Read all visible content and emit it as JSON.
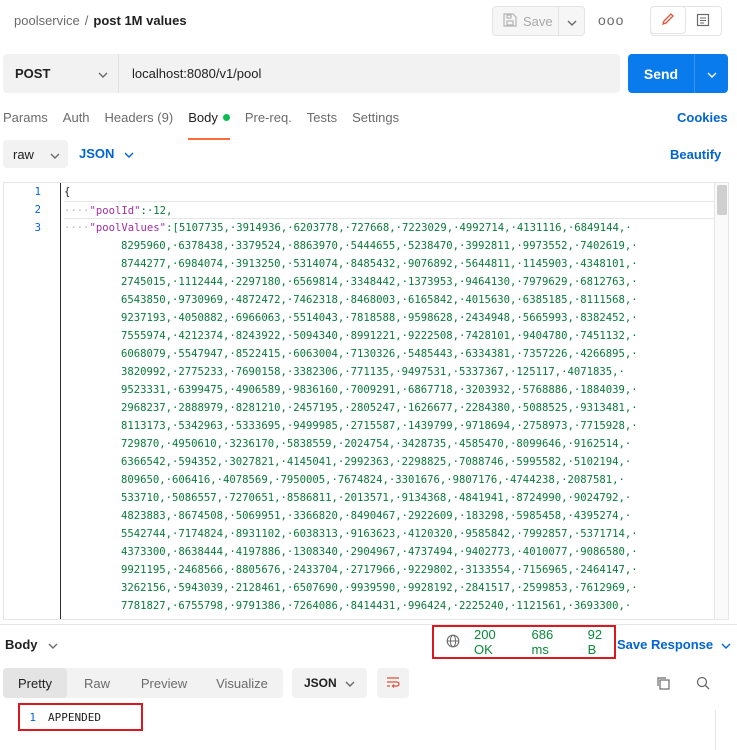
{
  "breadcrumb": {
    "parent": "poolservice",
    "separator": "/",
    "title": "post 1M values"
  },
  "toolbar": {
    "save_label": "Save",
    "more_label": "ooo"
  },
  "request": {
    "method": "POST",
    "url": "localhost:8080/v1/pool",
    "send_label": "Send"
  },
  "tabs": [
    {
      "label": "Params"
    },
    {
      "label": "Auth"
    },
    {
      "label": "Headers (9)"
    },
    {
      "label": "Body"
    },
    {
      "label": "Pre-req."
    },
    {
      "label": "Tests"
    },
    {
      "label": "Settings"
    }
  ],
  "cookies_label": "Cookies",
  "body_options": {
    "mode": "raw",
    "language": "JSON",
    "beautify_label": "Beautify"
  },
  "editor": {
    "line_numbers": [
      "1",
      "2",
      "3"
    ],
    "line1": "{",
    "line2_indent": "····",
    "line2_key": "\"poolId\"",
    "line2_rest": ":·12,",
    "line3_indent": "····",
    "line3_key": "\"poolValues\"",
    "line3_rest": ":[5107735,·3914936,·6203778,·727668,·7223029,·4992714,·4131116,·6849144,·",
    "continuation": [
      "8295960,·6378438,·3379524,·8863970,·5444655,·5238470,·3992811,·9973552,·7402619,·",
      "8744277,·6984074,·3913250,·5314074,·8485432,·9076892,·5644811,·1145903,·4348101,·",
      "2745015,·1112444,·2297180,·6569814,·3348442,·1373953,·9464130,·7979629,·6812763,·",
      "6543850,·9730969,·4872472,·7462318,·8468003,·6165842,·4015630,·6385185,·8111568,·",
      "9237193,·4050882,·6966063,·5514043,·7818588,·9598628,·2434948,·5665993,·8382452,·",
      "7555974,·4212374,·8243922,·5094340,·8991221,·9222508,·7428101,·9404780,·7451132,·",
      "6068079,·5547947,·8522415,·6063004,·7130326,·5485443,·6334381,·7357226,·4266895,·",
      "3820992,·2775233,·7690158,·3382306,·771135,·9497531,·5337367,·125117,·4071835,·",
      "9523331,·6399475,·4906589,·9836160,·7009291,·6867718,·3203932,·5768886,·1884039,·",
      "2968237,·2888979,·8281210,·2457195,·2805247,·1626677,·2284380,·5088525,·9313481,·",
      "8113173,·5342963,·5333695,·9499985,·2715587,·1439799,·9718694,·2758973,·7715928,·",
      "729870,·4950610,·3236170,·5838559,·2024754,·3428735,·4585470,·8099646,·9162514,·",
      "6366542,·594352,·3027821,·4145041,·2992363,·2298825,·7088746,·5995582,·5102194,·",
      "809650,·606416,·4078569,·7950005,·7674824,·3301676,·9807176,·4744238,·2087581,·",
      "533710,·5086557,·7270651,·8586811,·2013571,·9134368,·4841941,·8724990,·9024792,·",
      "4823883,·8674508,·5069951,·3366820,·8490467,·2922609,·183298,·5985458,·4395274,·",
      "5542744,·7174824,·8931102,·6038313,·9163623,·4120320,·9585842,·7992857,·5371714,·",
      "4373300,·8638444,·4197886,·1308340,·2904967,·4737494,·9402773,·4010077,·9086580,·",
      "9921195,·2468566,·8805676,·2433704,·2717966,·9229802,·3133554,·7156965,·2464147,·",
      "3262156,·5943039,·2128461,·6507690,·9939590,·9928192,·2841517,·2599853,·7612969,·",
      "7781827,·6755798,·9791386,·7264086,·8414431,·996424,·2225240,·1121561,·3693300,·"
    ]
  },
  "response": {
    "body_label": "Body",
    "status": "200 OK",
    "time": "686 ms",
    "size": "92 B",
    "save_response_label": "Save Response",
    "tabs": [
      {
        "label": "Pretty"
      },
      {
        "label": "Raw"
      },
      {
        "label": "Preview"
      },
      {
        "label": "Visualize"
      }
    ],
    "format": "JSON",
    "result_line_number": "1",
    "result_text": "APPENDED"
  },
  "colors": {
    "accent_tab": "#ff6c37",
    "send_button": "#097bed",
    "link_blue": "#0265d2",
    "status_green": "#0a8a3a",
    "highlight_red": "#d9181f"
  }
}
